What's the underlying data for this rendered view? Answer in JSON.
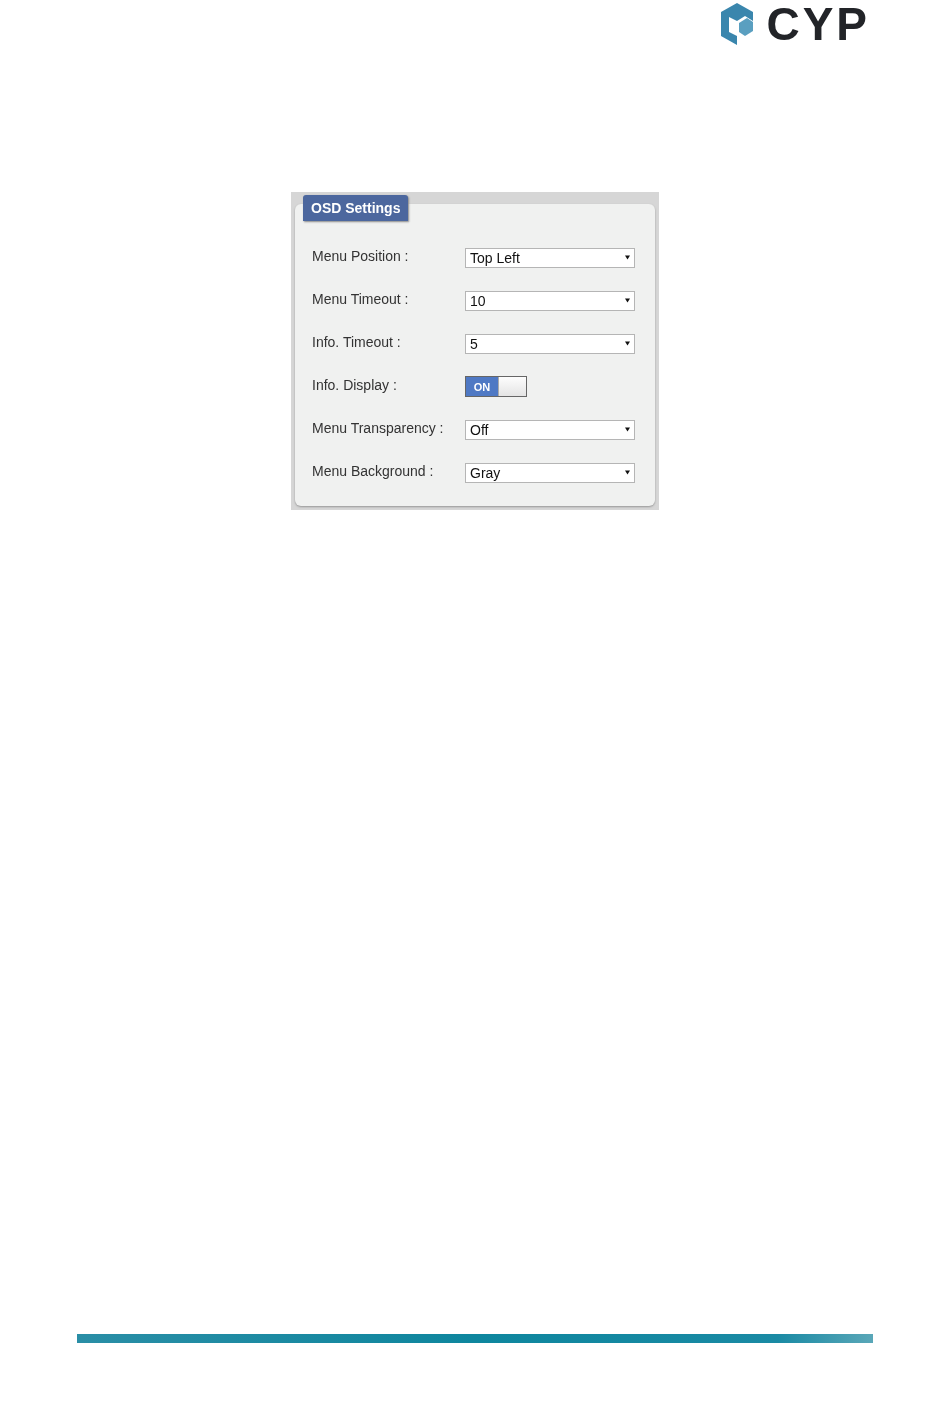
{
  "logo": {
    "text": "CYP"
  },
  "panel": {
    "title": "OSD Settings",
    "settings": [
      {
        "kind": "select",
        "label": "Menu Position :",
        "value": "Top Left"
      },
      {
        "kind": "select",
        "label": "Menu Timeout :",
        "value": "10"
      },
      {
        "kind": "select",
        "label": "Info. Timeout :",
        "value": "5"
      },
      {
        "kind": "toggle",
        "label": "Info. Display :",
        "on": true,
        "value": "ON"
      },
      {
        "kind": "select",
        "label": "Menu Transparency :",
        "value": "Off"
      },
      {
        "kind": "select",
        "label": "Menu Background :",
        "value": "Gray"
      }
    ]
  }
}
